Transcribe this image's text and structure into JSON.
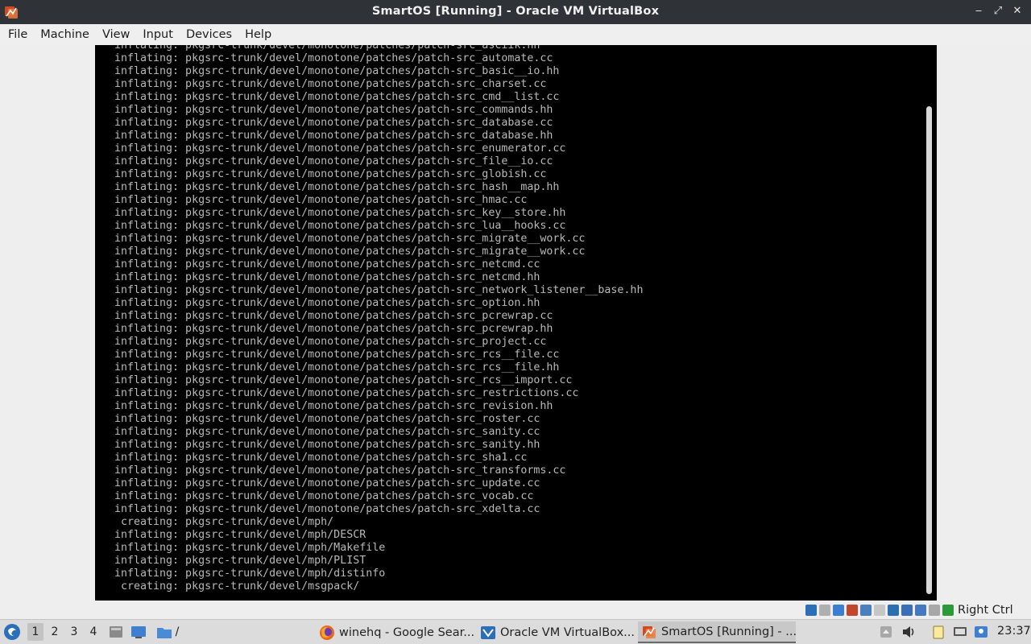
{
  "window": {
    "title": "SmartOS [Running] - Oracle VM VirtualBox",
    "icon": "virtualbox-icon"
  },
  "window_buttons": {
    "minimize": "‒",
    "maximize": "⤢",
    "close": "✕"
  },
  "menu": [
    "File",
    "Machine",
    "View",
    "Input",
    "Devices",
    "Help"
  ],
  "terminal": {
    "lines": [
      "inflating: pkgsrc-trunk/devel/monotone/patches/patch-src_asciik.hh",
      "inflating: pkgsrc-trunk/devel/monotone/patches/patch-src_automate.cc",
      "inflating: pkgsrc-trunk/devel/monotone/patches/patch-src_basic__io.hh",
      "inflating: pkgsrc-trunk/devel/monotone/patches/patch-src_charset.cc",
      "inflating: pkgsrc-trunk/devel/monotone/patches/patch-src_cmd__list.cc",
      "inflating: pkgsrc-trunk/devel/monotone/patches/patch-src_commands.hh",
      "inflating: pkgsrc-trunk/devel/monotone/patches/patch-src_database.cc",
      "inflating: pkgsrc-trunk/devel/monotone/patches/patch-src_database.hh",
      "inflating: pkgsrc-trunk/devel/monotone/patches/patch-src_enumerator.cc",
      "inflating: pkgsrc-trunk/devel/monotone/patches/patch-src_file__io.cc",
      "inflating: pkgsrc-trunk/devel/monotone/patches/patch-src_globish.cc",
      "inflating: pkgsrc-trunk/devel/monotone/patches/patch-src_hash__map.hh",
      "inflating: pkgsrc-trunk/devel/monotone/patches/patch-src_hmac.cc",
      "inflating: pkgsrc-trunk/devel/monotone/patches/patch-src_key__store.hh",
      "inflating: pkgsrc-trunk/devel/monotone/patches/patch-src_lua__hooks.cc",
      "inflating: pkgsrc-trunk/devel/monotone/patches/patch-src_migrate__work.cc",
      "inflating: pkgsrc-trunk/devel/monotone/patches/patch-src_migrate__work.cc",
      "inflating: pkgsrc-trunk/devel/monotone/patches/patch-src_netcmd.cc",
      "inflating: pkgsrc-trunk/devel/monotone/patches/patch-src_netcmd.hh",
      "inflating: pkgsrc-trunk/devel/monotone/patches/patch-src_network_listener__base.hh",
      "inflating: pkgsrc-trunk/devel/monotone/patches/patch-src_option.hh",
      "inflating: pkgsrc-trunk/devel/monotone/patches/patch-src_pcrewrap.cc",
      "inflating: pkgsrc-trunk/devel/monotone/patches/patch-src_pcrewrap.hh",
      "inflating: pkgsrc-trunk/devel/monotone/patches/patch-src_project.cc",
      "inflating: pkgsrc-trunk/devel/monotone/patches/patch-src_rcs__file.cc",
      "inflating: pkgsrc-trunk/devel/monotone/patches/patch-src_rcs__file.hh",
      "inflating: pkgsrc-trunk/devel/monotone/patches/patch-src_rcs__import.cc",
      "inflating: pkgsrc-trunk/devel/monotone/patches/patch-src_restrictions.cc",
      "inflating: pkgsrc-trunk/devel/monotone/patches/patch-src_revision.hh",
      "inflating: pkgsrc-trunk/devel/monotone/patches/patch-src_roster.cc",
      "inflating: pkgsrc-trunk/devel/monotone/patches/patch-src_sanity.cc",
      "inflating: pkgsrc-trunk/devel/monotone/patches/patch-src_sanity.hh",
      "inflating: pkgsrc-trunk/devel/monotone/patches/patch-src_sha1.cc",
      "inflating: pkgsrc-trunk/devel/monotone/patches/patch-src_transforms.cc",
      "inflating: pkgsrc-trunk/devel/monotone/patches/patch-src_update.cc",
      "inflating: pkgsrc-trunk/devel/monotone/patches/patch-src_vocab.cc",
      "inflating: pkgsrc-trunk/devel/monotone/patches/patch-src_xdelta.cc",
      " creating: pkgsrc-trunk/devel/mph/",
      "inflating: pkgsrc-trunk/devel/mph/DESCR",
      "inflating: pkgsrc-trunk/devel/mph/Makefile",
      "inflating: pkgsrc-trunk/devel/mph/PLIST",
      "inflating: pkgsrc-trunk/devel/mph/distinfo",
      " creating: pkgsrc-trunk/devel/msgpack/"
    ]
  },
  "vbox_status": {
    "icons": [
      "hard-disk-icon",
      "optical-drive-icon",
      "audio-icon",
      "network-icon",
      "usb-icon",
      "shared-folders-icon",
      "display-icon",
      "video-capture-icon",
      "virtualization-icon",
      "mouse-integration-icon",
      "keyboard-capture-icon"
    ],
    "icon_colors": [
      "#2a6fb8",
      "#b0b0b0",
      "#3c7ed0",
      "#c4452e",
      "#4a7fc0",
      "#c6c6c6",
      "#2b6fae",
      "#3a6fb8",
      "#4479c2",
      "#a8a8a8",
      "#2a9a3a"
    ],
    "host_key": "Right Ctrl"
  },
  "taskbar": {
    "start_icon": "start-menu-icon",
    "workspaces": [
      "1",
      "2",
      "3",
      "4"
    ],
    "active_workspace": "1",
    "quicklaunch": [
      {
        "icon": "file-manager-icon",
        "color": "#8a8a8a"
      },
      {
        "icon": "desktop-icon",
        "color": "#3f7fcf"
      },
      {
        "icon": "folder-icon",
        "color": "#4a8bd6"
      }
    ],
    "folder_label": "/",
    "tasks": [
      {
        "label": "winehq - Google Sear...",
        "icon": "firefox-icon",
        "active": false
      },
      {
        "label": "Oracle VM VirtualBox...",
        "icon": "virtualbox-manager-icon",
        "active": false
      },
      {
        "label": "SmartOS [Running] - ...",
        "icon": "virtualbox-vm-icon",
        "active": true
      }
    ],
    "tray": [
      "notification-arrow-icon",
      "volume-icon",
      "clipboard-icon",
      "network-tray-icon",
      "user-tray-icon"
    ],
    "clock": "23:37"
  }
}
